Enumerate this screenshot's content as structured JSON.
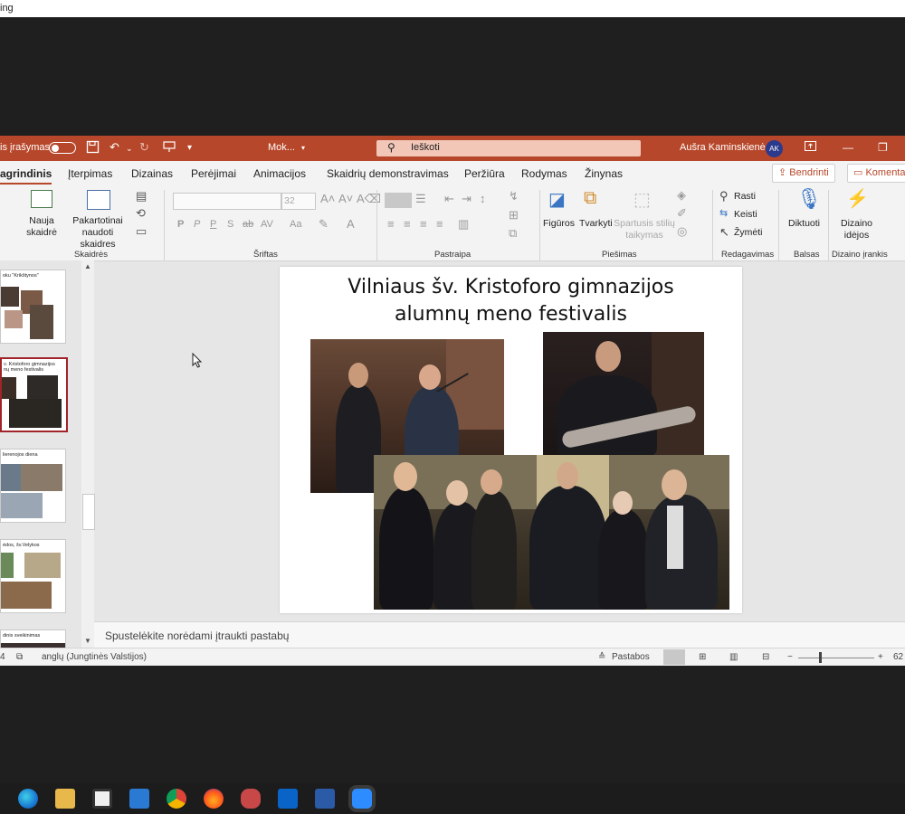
{
  "top_strip": {
    "text": "ing"
  },
  "titlebar": {
    "autosave_label": "is įrašymas",
    "file_name": "Mok...",
    "search_placeholder": "Ieškoti",
    "user_name": "Aušra Kaminskienė",
    "user_initials": "AK"
  },
  "tabs": [
    {
      "label": "agrindinis",
      "active": true
    },
    {
      "label": "Įterpimas"
    },
    {
      "label": "Dizainas"
    },
    {
      "label": "Perėjimai"
    },
    {
      "label": "Animacijos"
    },
    {
      "label": "Skaidrių demonstravimas"
    },
    {
      "label": "Peržiūra"
    },
    {
      "label": "Rodymas"
    },
    {
      "label": "Žinynas"
    }
  ],
  "share_button": "Bendrinti",
  "comments_button": "Komenta",
  "ribbon": {
    "new_slide": "Nauja\nskaidrė",
    "reuse_slides": "Pakartotinai\nnaudoti skaidres",
    "font_size": "32",
    "shapes": "Figūros",
    "arrange": "Tvarkyti",
    "quick_styles": "Spartusis stilių\ntaikymas",
    "find": "Rasti",
    "replace": "Keisti",
    "select": "Žymėti",
    "dictate": "Diktuoti",
    "design_ideas": "Dizaino\nidėjos",
    "groups": {
      "slides": "Skaidrės",
      "font": "Šriftas",
      "paragraph": "Pastraipa",
      "drawing": "Piešimas",
      "editing": "Redagavimas",
      "voice": "Balsas",
      "designer": "Dizaino įrankis"
    }
  },
  "thumbnails": [
    {
      "caption": "oku \"Krikštynos\""
    },
    {
      "caption": "ν. Kristoforo gimnazijos\nnų meno festivalis"
    },
    {
      "caption": "lierenojos diena"
    },
    {
      "caption": "ėdos, šv.Velykos"
    },
    {
      "caption": "dinis sveikinimas"
    }
  ],
  "slide": {
    "title_line1": "Vilniaus šv. Kristoforo gimnazijos",
    "title_line2": "alumnų meno festivalis"
  },
  "notes_placeholder": "Spustelėkite norėdami įtraukti pastabų",
  "status": {
    "language": "anglų (Jungtinės Valstijos)",
    "notes_button": "Pastabos",
    "zoom": "62"
  },
  "colors": {
    "accent": "#b7472a",
    "selected_thumb": "#a1242a"
  }
}
